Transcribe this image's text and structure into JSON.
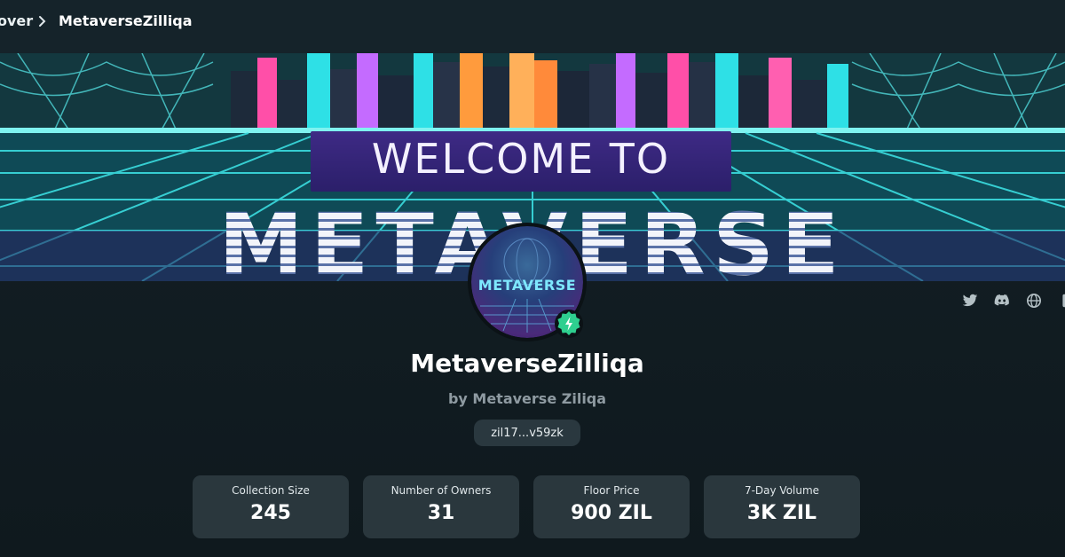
{
  "breadcrumb": {
    "previous": "over",
    "current": "MetaverseZilliqa"
  },
  "banner": {
    "line1": "WELCOME TO",
    "line2": "METAVERSE"
  },
  "avatar": {
    "word": "METAVERSE"
  },
  "collection": {
    "name": "MetaverseZilliqa",
    "byline": "by Metaverse Ziliqa",
    "address": "zil17...v59zk"
  },
  "socials": [
    "twitter-icon",
    "discord-icon",
    "globe-icon",
    "other-icon"
  ],
  "stats": [
    {
      "label": "Collection Size",
      "value": "245"
    },
    {
      "label": "Number of Owners",
      "value": "31"
    },
    {
      "label": "Floor Price",
      "value": "900 ZIL"
    },
    {
      "label": "7-Day Volume",
      "value": "3K ZIL"
    }
  ],
  "colors": {
    "verified": "#2ecf8f",
    "card": "#2a373d",
    "background": "#111b20"
  }
}
